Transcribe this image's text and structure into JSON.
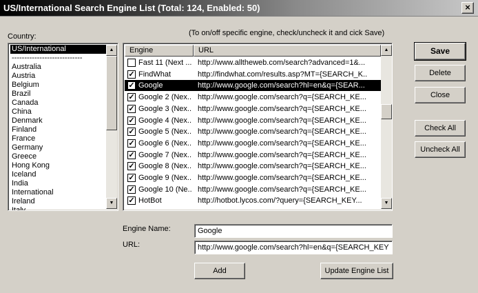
{
  "window": {
    "title": "US/International Search Engine List (Total: 124, Enabled: 50)",
    "close_glyph": "×"
  },
  "country": {
    "label": "Country:",
    "items": [
      "US/International",
      "----------------------------",
      "Australia",
      "Austria",
      "Belgium",
      "Brazil",
      "Canada",
      "China",
      "Denmark",
      "Finland",
      "France",
      "Germany",
      "Greece",
      "Hong Kong",
      "Iceland",
      "India",
      "International",
      "Ireland",
      "Italy"
    ],
    "selected_index": 0
  },
  "hint": "(To on/off specific engine, check/uncheck it and cick Save)",
  "engines": {
    "columns": [
      "Engine",
      "URL"
    ],
    "rows": [
      {
        "name": "Fast 11 (Next ...",
        "url": "http://www.alltheweb.com/search?advanced=1&...",
        "checked": false
      },
      {
        "name": "FindWhat",
        "url": "http://findwhat.com/results.asp?MT={SEARCH_K...",
        "checked": true
      },
      {
        "name": "Google",
        "url": "http://www.google.com/search?hl=en&q={SEAR...",
        "checked": true
      },
      {
        "name": "Google 2 (Nex...",
        "url": "http://www.google.com/search?q={SEARCH_KE...",
        "checked": true
      },
      {
        "name": "Google 3 (Nex...",
        "url": "http://www.google.com/search?q={SEARCH_KE...",
        "checked": true
      },
      {
        "name": "Google 4 (Nex...",
        "url": "http://www.google.com/search?q={SEARCH_KE...",
        "checked": true
      },
      {
        "name": "Google 5 (Nex...",
        "url": "http://www.google.com/search?q={SEARCH_KE...",
        "checked": true
      },
      {
        "name": "Google 6 (Nex...",
        "url": "http://www.google.com/search?q={SEARCH_KE...",
        "checked": true
      },
      {
        "name": "Google 7 (Nex...",
        "url": "http://www.google.com/search?q={SEARCH_KE...",
        "checked": true
      },
      {
        "name": "Google 8 (Nex...",
        "url": "http://www.google.com/search?q={SEARCH_KE...",
        "checked": true
      },
      {
        "name": "Google 9 (Nex...",
        "url": "http://www.google.com/search?q={SEARCH_KE...",
        "checked": true
      },
      {
        "name": "Google 10 (Ne...",
        "url": "http://www.google.com/search?q={SEARCH_KE...",
        "checked": true
      },
      {
        "name": "HotBot",
        "url": "http://hotbot.lycos.com/?query={SEARCH_KEY...",
        "checked": true
      }
    ],
    "selected_index": 2,
    "check_glyph": "✓"
  },
  "buttons": {
    "save": "Save",
    "delete": "Delete",
    "close": "Close",
    "check_all": "Check All",
    "uncheck_all": "Uncheck All",
    "add": "Add",
    "update": "Update Engine List"
  },
  "form": {
    "engine_name_label": "Engine Name:",
    "engine_name_value": "Google",
    "url_label": "URL:",
    "url_value": "http://www.google.com/search?hl=en&q={SEARCH_KEY"
  },
  "icons": {
    "scroll_up": "▲",
    "scroll_down": "▼"
  }
}
